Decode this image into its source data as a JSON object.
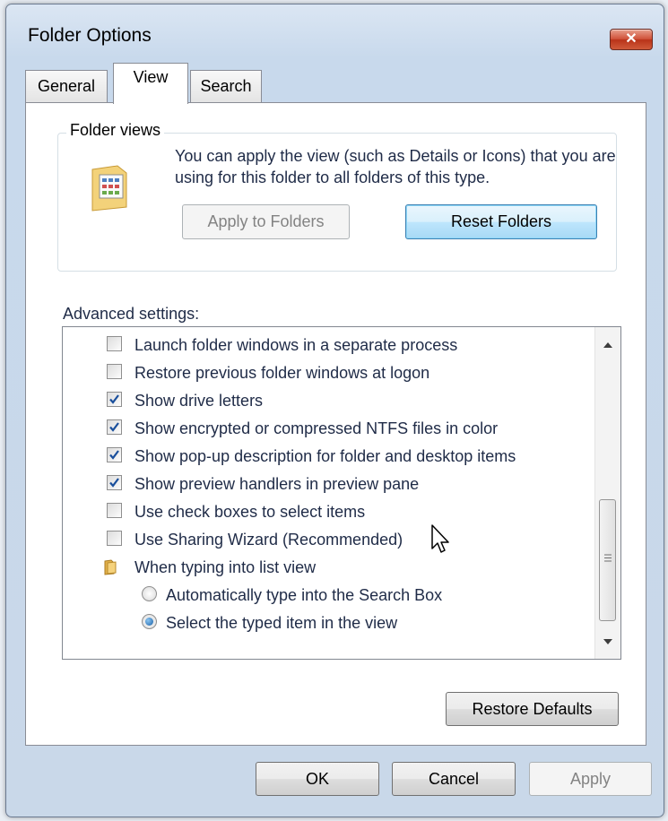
{
  "window": {
    "title": "Folder Options",
    "close_symbol": "✕"
  },
  "tabs": [
    {
      "label": "General"
    },
    {
      "label": "View"
    },
    {
      "label": "Search"
    }
  ],
  "folder_views": {
    "group_label": "Folder views",
    "description": "You can apply the view (such as Details or Icons) that you are using for this folder to all folders of this type.",
    "apply_button": "Apply to Folders",
    "reset_button": "Reset Folders"
  },
  "advanced": {
    "label": "Advanced settings:",
    "items": [
      {
        "type": "checkbox",
        "label": "Launch folder windows in a separate process",
        "checked": false
      },
      {
        "type": "checkbox",
        "label": "Restore previous folder windows at logon",
        "checked": false
      },
      {
        "type": "checkbox",
        "label": "Show drive letters",
        "checked": true
      },
      {
        "type": "checkbox",
        "label": "Show encrypted or compressed NTFS files in color",
        "checked": true
      },
      {
        "type": "checkbox",
        "label": "Show pop-up description for folder and desktop items",
        "checked": true
      },
      {
        "type": "checkbox",
        "label": "Show preview handlers in preview pane",
        "checked": true
      },
      {
        "type": "checkbox",
        "label": "Use check boxes to select items",
        "checked": false
      },
      {
        "type": "checkbox",
        "label": "Use Sharing Wizard (Recommended)",
        "checked": false
      },
      {
        "type": "folder",
        "label": "When typing into list view"
      },
      {
        "type": "radio",
        "label": "Automatically type into the Search Box",
        "selected": false
      },
      {
        "type": "radio",
        "label": "Select the typed item in the view",
        "selected": true
      }
    ],
    "restore_button": "Restore Defaults"
  },
  "footer": {
    "ok": "OK",
    "cancel": "Cancel",
    "apply": "Apply"
  },
  "colors": {
    "accent": "#3c7fb1",
    "check": "#1a4f9c",
    "close": "#c4432a"
  }
}
